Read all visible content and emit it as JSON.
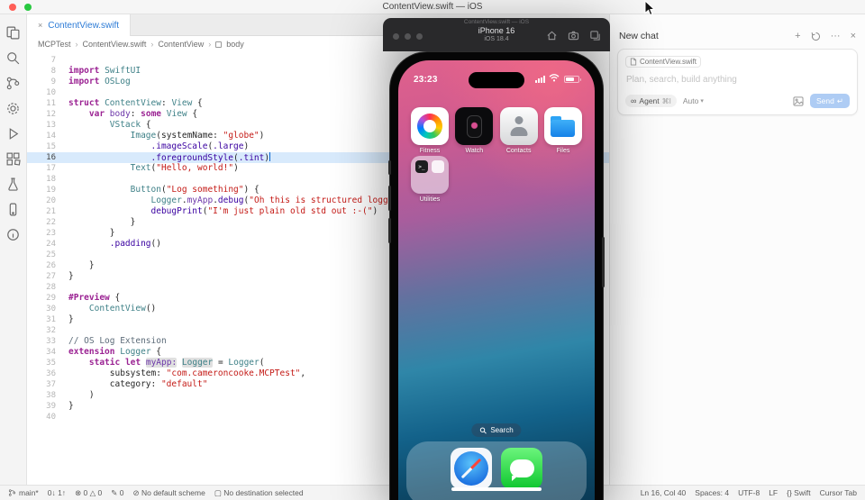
{
  "menubar": {
    "title": "ContentView.swift — iOS"
  },
  "tab": {
    "label": "ContentView.swift"
  },
  "icons": {
    "tab_close": "×",
    "breadcrumb_sep": "›",
    "chat_plus": "+",
    "chat_more": "···",
    "chat_close": "×",
    "agent_infinity": "∞",
    "mode_chevron": "▾",
    "send_return": "↵"
  },
  "breadcrumb": {
    "items": [
      "MCPTest",
      "ContentView.swift",
      "ContentView",
      "body"
    ]
  },
  "editor": {
    "active_line": 16,
    "lines": [
      {
        "n": 7,
        "s": []
      },
      {
        "n": 8,
        "s": [
          [
            "k",
            "import"
          ],
          [
            "p",
            " "
          ],
          [
            "t",
            "SwiftUI"
          ]
        ]
      },
      {
        "n": 9,
        "s": [
          [
            "k",
            "import"
          ],
          [
            "p",
            " "
          ],
          [
            "t",
            "OSLog"
          ]
        ]
      },
      {
        "n": 10,
        "s": []
      },
      {
        "n": 11,
        "s": [
          [
            "k",
            "struct"
          ],
          [
            "p",
            " "
          ],
          [
            "t",
            "ContentView"
          ],
          [
            "p",
            ": "
          ],
          [
            "t",
            "View"
          ],
          [
            "p",
            " {"
          ]
        ]
      },
      {
        "n": 12,
        "s": [
          [
            "p",
            "    "
          ],
          [
            "k",
            "var"
          ],
          [
            "p",
            " "
          ],
          [
            "pr",
            "body"
          ],
          [
            "p",
            ": "
          ],
          [
            "k",
            "some"
          ],
          [
            "p",
            " "
          ],
          [
            "t",
            "View"
          ],
          [
            "p",
            " {"
          ]
        ]
      },
      {
        "n": 13,
        "s": [
          [
            "p",
            "        "
          ],
          [
            "t",
            "VStack"
          ],
          [
            "p",
            " {"
          ]
        ]
      },
      {
        "n": 14,
        "s": [
          [
            "p",
            "            "
          ],
          [
            "t",
            "Image"
          ],
          [
            "p",
            "(systemName: "
          ],
          [
            "s",
            "\"globe\""
          ],
          [
            "p",
            ")"
          ]
        ]
      },
      {
        "n": 15,
        "s": [
          [
            "p",
            "                "
          ],
          [
            "f",
            ".imageScale"
          ],
          [
            "p",
            "("
          ],
          [
            "f",
            ".large"
          ],
          [
            "p",
            ")"
          ]
        ]
      },
      {
        "n": 16,
        "s": [
          [
            "p",
            "                "
          ],
          [
            "f",
            ".foregroundStyle"
          ],
          [
            "p",
            "("
          ],
          [
            "f",
            ".tint"
          ],
          [
            "p",
            ")"
          ]
        ]
      },
      {
        "n": 17,
        "s": [
          [
            "p",
            "            "
          ],
          [
            "t",
            "Text"
          ],
          [
            "p",
            "("
          ],
          [
            "s",
            "\"Hello, world!\""
          ],
          [
            "p",
            ")"
          ]
        ]
      },
      {
        "n": 18,
        "s": []
      },
      {
        "n": 19,
        "s": [
          [
            "p",
            "            "
          ],
          [
            "t",
            "Button"
          ],
          [
            "p",
            "("
          ],
          [
            "s",
            "\"Log something\""
          ],
          [
            "p",
            ") {"
          ]
        ]
      },
      {
        "n": 20,
        "s": [
          [
            "p",
            "                "
          ],
          [
            "t",
            "Logger"
          ],
          [
            "p",
            "."
          ],
          [
            "pr",
            "myApp"
          ],
          [
            "p",
            "."
          ],
          [
            "f",
            "debug"
          ],
          [
            "p",
            "("
          ],
          [
            "s",
            "\"Oh this is structured logging\""
          ],
          [
            "p",
            ")"
          ]
        ]
      },
      {
        "n": 21,
        "s": [
          [
            "p",
            "                "
          ],
          [
            "f",
            "debugPrint"
          ],
          [
            "p",
            "("
          ],
          [
            "s",
            "\"I'm just plain old std out :-(\""
          ],
          [
            "p",
            ")"
          ]
        ]
      },
      {
        "n": 22,
        "s": [
          [
            "p",
            "            }"
          ]
        ]
      },
      {
        "n": 23,
        "s": [
          [
            "p",
            "        }"
          ]
        ]
      },
      {
        "n": 24,
        "s": [
          [
            "p",
            "        "
          ],
          [
            "f",
            ".padding"
          ],
          [
            "p",
            "()"
          ]
        ]
      },
      {
        "n": 25,
        "s": []
      },
      {
        "n": 26,
        "s": [
          [
            "p",
            "    }"
          ]
        ]
      },
      {
        "n": 27,
        "s": [
          [
            "p",
            "}"
          ]
        ]
      },
      {
        "n": 28,
        "s": []
      },
      {
        "n": 29,
        "s": [
          [
            "k",
            "#Preview"
          ],
          [
            "p",
            " {"
          ]
        ]
      },
      {
        "n": 30,
        "s": [
          [
            "p",
            "    "
          ],
          [
            "t",
            "ContentView"
          ],
          [
            "p",
            "()"
          ]
        ]
      },
      {
        "n": 31,
        "s": [
          [
            "p",
            "}"
          ]
        ]
      },
      {
        "n": 32,
        "s": []
      },
      {
        "n": 33,
        "s": [
          [
            "c",
            "// OS Log Extension"
          ]
        ]
      },
      {
        "n": 34,
        "s": [
          [
            "k",
            "extension"
          ],
          [
            "p",
            " "
          ],
          [
            "t",
            "Logger"
          ],
          [
            "p",
            " {"
          ]
        ]
      },
      {
        "n": 35,
        "s": [
          [
            "p",
            "    "
          ],
          [
            "k",
            "static"
          ],
          [
            "p",
            " "
          ],
          [
            "k",
            "let"
          ],
          [
            "p",
            " "
          ],
          [
            "pr hl",
            "myApp:"
          ],
          [
            "p",
            " "
          ],
          [
            "t hl",
            "Logger"
          ],
          [
            "p",
            " = "
          ],
          [
            "t",
            "Logger"
          ],
          [
            "p",
            "("
          ]
        ]
      },
      {
        "n": 36,
        "s": [
          [
            "p",
            "        subsystem: "
          ],
          [
            "s",
            "\"com.cameroncooke.MCPTest\""
          ],
          [
            "p",
            ","
          ]
        ]
      },
      {
        "n": 37,
        "s": [
          [
            "p",
            "        category: "
          ],
          [
            "s",
            "\"default\""
          ]
        ]
      },
      {
        "n": 38,
        "s": [
          [
            "p",
            "    )"
          ]
        ]
      },
      {
        "n": 39,
        "s": [
          [
            "p",
            "}"
          ]
        ]
      },
      {
        "n": 40,
        "s": []
      }
    ]
  },
  "simulator": {
    "back_title": "ContentView.swift — iOS",
    "device": "iPhone 16",
    "os": "iOS 18.4",
    "time": "23:23",
    "apps": [
      {
        "label": "Fitness"
      },
      {
        "label": "Watch"
      },
      {
        "label": "Contacts"
      },
      {
        "label": "Files"
      }
    ],
    "utilities_label": "Utilities",
    "search_label": "Search"
  },
  "chat": {
    "header": "New chat",
    "context_chip": "ContentView.swift",
    "placeholder": "Plan, search, build anything",
    "agent_label": "Agent",
    "agent_kbd": "⌘I",
    "mode": "Auto",
    "send_label": "Send"
  },
  "statusbar": {
    "branch": "main*",
    "left_rest": [
      "0↓ 1↑",
      "⊗ 0  △ 0",
      "✎ 0",
      "⊘ No default scheme",
      "▢ No destination selected"
    ],
    "right": [
      "Ln 16, Col 40",
      "Spaces: 4",
      "UTF-8",
      "LF",
      "{} Swift",
      "Cursor Tab"
    ]
  },
  "colors": {
    "accent_blue": "#2c7bd6",
    "keyword": "#9B2393",
    "type": "#3E8087",
    "string": "#C41A16",
    "function": "#3900A0",
    "comment": "#5D6C79",
    "active_line": "#d8eafc",
    "messages_green": "#0ec62f",
    "files_blue": "#1581e8"
  }
}
